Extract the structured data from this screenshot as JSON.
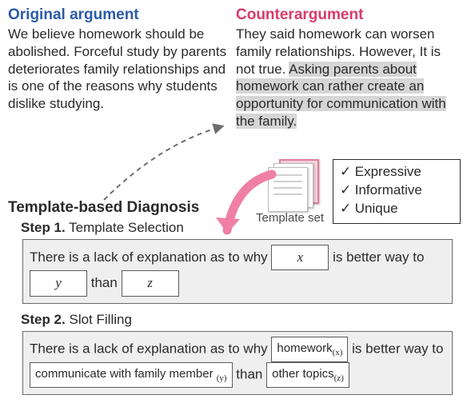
{
  "original": {
    "title": "Original argument",
    "text": "We believe homework should be abolished. Forceful study by parents deteriorates family relationships and is one of the reasons why students dislike studying."
  },
  "counter": {
    "title": "Counterargument",
    "pre": "They said homework can worsen family relationships. However, It is not true. ",
    "highlight": "Asking parents about homework can rather create an opportunity for communication with the family."
  },
  "criteria": [
    "Expressive",
    "Informative",
    "Unique"
  ],
  "template_set_label": "Template set",
  "section_title": "Template-based Diagnosis",
  "step1": {
    "label": "Step 1.",
    "title": "Template Selection",
    "t_a": "There is a lack of explanation as to why ",
    "x": "x",
    "t_b": " is better way to ",
    "y": "y",
    "t_c": " than ",
    "z": "z"
  },
  "step2": {
    "label": "Step 2.",
    "title": "Slot Filling",
    "t_a": "There is a lack of explanation as to why ",
    "x": "homework",
    "x_sub": "(x)",
    "t_b": " is better way to ",
    "y": "communicate with family member ",
    "y_sub": "(y)",
    "t_c": " than ",
    "z": "other topics",
    "z_sub": "(z)"
  }
}
